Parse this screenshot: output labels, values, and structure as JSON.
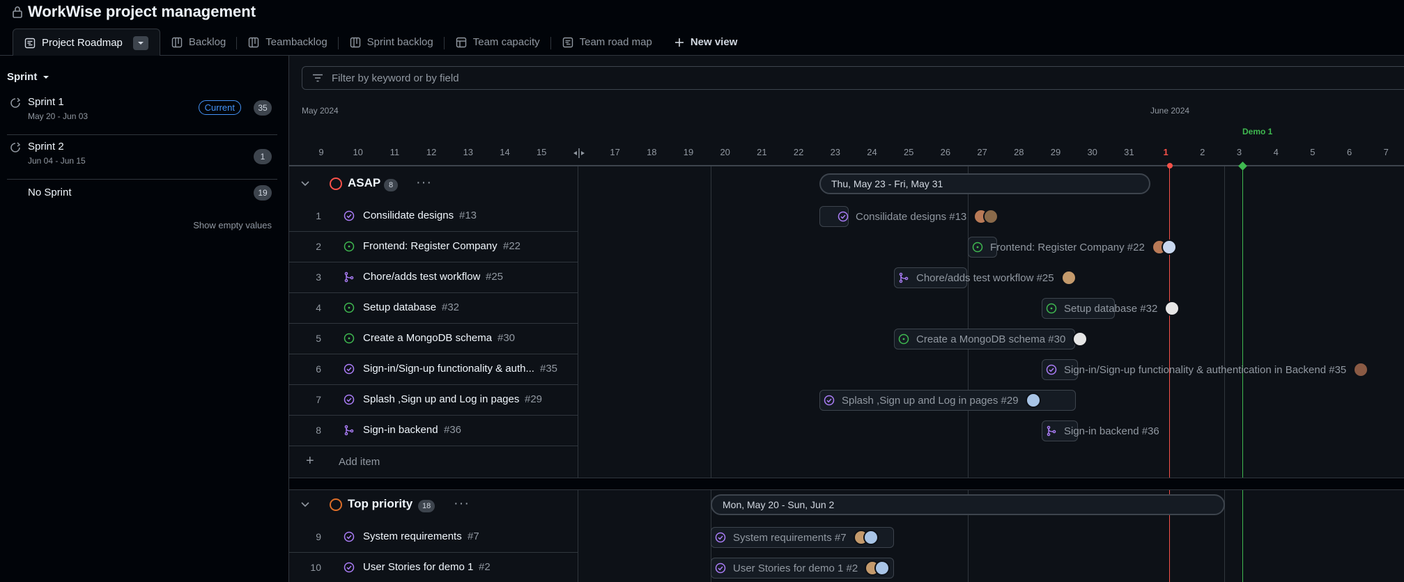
{
  "app": {
    "title": "WorkWise project management"
  },
  "tabs": [
    {
      "label": "Project Roadmap",
      "icon": "roadmap-icon"
    },
    {
      "label": "Backlog",
      "icon": "board-icon"
    },
    {
      "label": "Teambacklog",
      "icon": "board-icon"
    },
    {
      "label": "Sprint backlog",
      "icon": "board-icon"
    },
    {
      "label": "Team capacity",
      "icon": "table-icon"
    },
    {
      "label": "Team road map",
      "icon": "roadmap-icon"
    },
    {
      "label": "New view",
      "icon": "plus-icon"
    }
  ],
  "sidebar": {
    "field_label": "Sprint",
    "sprints": [
      {
        "name": "Sprint 1",
        "dates": "May 20 - Jun 03",
        "badge": "Current",
        "count": "35"
      },
      {
        "name": "Sprint 2",
        "dates": "Jun 04 - Jun 15",
        "count": "1"
      },
      {
        "name": "No Sprint",
        "count": "19"
      }
    ],
    "show_empty": "Show empty values"
  },
  "filter": {
    "placeholder": "Filter by keyword or by field"
  },
  "timeline": {
    "months": [
      "May 2024",
      "June 2024"
    ],
    "days": [
      "9",
      "10",
      "11",
      "12",
      "13",
      "14",
      "15",
      "",
      "17",
      "18",
      "19",
      "20",
      "21",
      "22",
      "23",
      "24",
      "25",
      "26",
      "27",
      "28",
      "29",
      "30",
      "31",
      "1",
      "2",
      "3",
      "4",
      "5",
      "6",
      "7"
    ],
    "today_day": "1",
    "marker_label": "Demo 1"
  },
  "groups": [
    {
      "name": "ASAP",
      "count": "8",
      "range_label": "Thu, May 23 - Fri, May 31",
      "items": [
        {
          "num": "1",
          "title": "Consilidate designs",
          "id": "#13",
          "type": "done",
          "bar_label": "Consilidate designs #13"
        },
        {
          "num": "2",
          "title": "Frontend: Register Company",
          "id": "#22",
          "type": "open",
          "bar_label": "Frontend: Register Company #22"
        },
        {
          "num": "3",
          "title": "Chore/adds test workflow",
          "id": "#25",
          "type": "pr",
          "bar_label": "Chore/adds test workflow #25"
        },
        {
          "num": "4",
          "title": "Setup database",
          "id": "#32",
          "type": "open",
          "bar_label": "Setup database #32"
        },
        {
          "num": "5",
          "title": "Create a MongoDB schema",
          "id": "#30",
          "type": "open",
          "bar_label": "Create a MongoDB schema #30"
        },
        {
          "num": "6",
          "title": "Sign-in/Sign-up functionality & auth...",
          "id": "#35",
          "type": "done",
          "bar_label": "Sign-in/Sign-up functionality & authentication in Backend #35"
        },
        {
          "num": "7",
          "title": "Splash ,Sign up and Log in pages",
          "id": "#29",
          "type": "done",
          "bar_label": "Splash ,Sign up and Log in pages #29"
        },
        {
          "num": "8",
          "title": "Sign-in backend",
          "id": "#36",
          "type": "pr",
          "bar_label": "Sign-in backend #36"
        }
      ],
      "add_item": "Add item"
    },
    {
      "name": "Top priority",
      "count": "18",
      "range_label": "Mon, May 20 - Sun, Jun 2",
      "items": [
        {
          "num": "9",
          "title": "System requirements",
          "id": "#7",
          "type": "done",
          "bar_label": "System requirements #7"
        },
        {
          "num": "10",
          "title": "User Stories for demo 1",
          "id": "#2",
          "type": "done",
          "bar_label": "User Stories for demo 1 #2"
        }
      ]
    }
  ],
  "colors": {
    "asap": "#f85149",
    "top_priority": "#db6d28",
    "today": "#f85149",
    "demo": "#3fb950",
    "done": "#ab7df8",
    "open": "#3fb950",
    "accent": "#4493f8"
  }
}
